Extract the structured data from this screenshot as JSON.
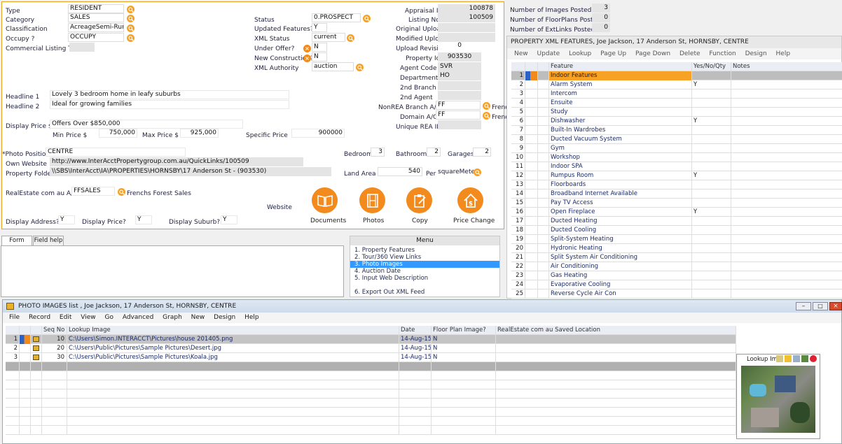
{
  "form": {
    "type_label": "Type",
    "type_value": "RESIDENT",
    "category_label": "Category",
    "category_value": "SALES",
    "classification_label": "Classification",
    "classification_value": "AcreageSemi-Rural",
    "occupy_label": "Occupy ?",
    "occupy_value": "OCCUPY",
    "commercial_label": "Commercial Listing Type",
    "status_label": "Status",
    "status_value": "0.PROSPECT",
    "updated_label": "Updated Features?",
    "updated_value": "Y",
    "xmlstatus_label": "XML Status",
    "xmlstatus_value": "current",
    "underoffer_label": "Under Offer?",
    "underoffer_value": "N",
    "newcon_label": "New Construction?",
    "newcon_value": "N",
    "xmlauth_label": "XML Authority",
    "xmlauth_value": "auction",
    "appraisal_label": "Appraisal Id",
    "appraisal_value": "100878",
    "listing_label": "Listing No",
    "listing_value": "100509",
    "origupload_label": "Original Upload",
    "modupload_label": "Modified Upload",
    "uprev_label": "Upload Revision",
    "uprev_value": "0",
    "propid_label": "Property Id",
    "propid_value": "903530",
    "agentcode_label": "Agent Code",
    "agentcode_value": "SVR",
    "dept_label": "Department",
    "dept_value": "HO",
    "branch2_label": "2nd Branch",
    "agent2_label": "2nd Agent",
    "nonrea_label": "NonREA Branch A/c",
    "nonrea_value": "FF",
    "nonrea_extra": "Frenc",
    "domain_label": "Domain A/C",
    "domain_value": "FF",
    "domain_extra": "Frenc",
    "uniquerea_label": "Unique REA ID",
    "headline1_label": "Headline 1",
    "headline1_value": "Lovely 3 bedroom home in leafy suburbs",
    "headline2_label": "Headline 2",
    "headline2_value": "Ideal for growing families",
    "dispprice_label": "Display Price $",
    "dispprice_value": "Offers Over $850,000",
    "minprice_label": "Min Price $",
    "minprice_value": "750,000",
    "maxprice_label": "Max Price $",
    "maxprice_value": "925,000",
    "specprice_label": "Specific Price",
    "specprice_value": "900000",
    "photopos_label": "*Photo Positions",
    "photopos_value": "CENTRE",
    "website_label": "Own Website",
    "website_value": "http://www.InterAcctPropertygroup.com.au/QuickLinks/100509",
    "folder_label": "Property Folder",
    "folder_value": "\\\\SBS\\InterAcct\\IA\\PROPERTIES\\HORNSBY\\17 Anderson St  - (903530)",
    "bed_label": "Bedrooms",
    "bed_value": "3",
    "bath_label": "Bathrooms",
    "bath_value": "2",
    "garage_label": "Garages",
    "garage_value": "2",
    "land_label": "Land Area",
    "land_value": "540",
    "per_label": "Per",
    "per_value": "squareMeter",
    "rea_label": "RealEstate com au A/c",
    "rea_value": "FFSALES",
    "rea_name": "Frenchs Forest Sales",
    "web_label": "Website",
    "dispaddr_label": "Display Address?",
    "dispaddr_value": "Y",
    "dispprice2_label": "Display Price?",
    "dispprice2_value": "Y",
    "dispsub_label": "Display Suburb?",
    "dispsub_value": "Y",
    "btn_documents": "Documents",
    "btn_photos": "Photos",
    "btn_copy": "Copy",
    "btn_price": "Price Change"
  },
  "counts": {
    "images_label": "Number of Images Posted",
    "images_value": "3",
    "floor_label": "Number of FloorPlans Posted",
    "floor_value": "0",
    "ext_label": "Number of ExtLinks Posted",
    "ext_value": "0"
  },
  "help": {
    "tab_form": "Form help",
    "tab_field": "Field help"
  },
  "menu": {
    "title": "Menu",
    "items": [
      "1. Property Features",
      "2. Tour/360 View Links",
      "3. Photo Images",
      "4. Auction Date",
      "5. Input Web Description",
      "6. Export Out XML Feed"
    ]
  },
  "features": {
    "title": "PROPERTY XML FEATURES, Joe Jackson, 17 Anderson St, HORNSBY, CENTRE",
    "menu": [
      "New",
      "Update",
      "Lookup",
      "Page Up",
      "Page Down",
      "Delete",
      "Function",
      "Design",
      "Help"
    ],
    "col_feature": "Feature",
    "col_yn": "Yes/No/Qty",
    "col_notes": "Notes",
    "rows": [
      {
        "n": "1",
        "f": "Indoor Features",
        "y": ""
      },
      {
        "n": "2",
        "f": "Alarm System",
        "y": "Y"
      },
      {
        "n": "3",
        "f": "Intercom",
        "y": ""
      },
      {
        "n": "4",
        "f": "Ensuite",
        "y": ""
      },
      {
        "n": "5",
        "f": "Study",
        "y": ""
      },
      {
        "n": "6",
        "f": "Dishwasher",
        "y": "Y"
      },
      {
        "n": "7",
        "f": "Built-In Wardrobes",
        "y": ""
      },
      {
        "n": "8",
        "f": "Ducted Vacuum System",
        "y": ""
      },
      {
        "n": "9",
        "f": "Gym",
        "y": ""
      },
      {
        "n": "10",
        "f": "Workshop",
        "y": ""
      },
      {
        "n": "11",
        "f": "Indoor SPA",
        "y": ""
      },
      {
        "n": "12",
        "f": "Rumpus Room",
        "y": "Y"
      },
      {
        "n": "13",
        "f": "Floorboards",
        "y": ""
      },
      {
        "n": "14",
        "f": "Broadband Internet Available",
        "y": ""
      },
      {
        "n": "15",
        "f": "Pay TV Access",
        "y": ""
      },
      {
        "n": "16",
        "f": "Open Fireplace",
        "y": "Y"
      },
      {
        "n": "17",
        "f": "Ducted Heating",
        "y": ""
      },
      {
        "n": "18",
        "f": "Ducted Cooling",
        "y": ""
      },
      {
        "n": "19",
        "f": "Split-System Heating",
        "y": ""
      },
      {
        "n": "20",
        "f": "Hydronic Heating",
        "y": ""
      },
      {
        "n": "21",
        "f": "Split System Air Conditioning",
        "y": ""
      },
      {
        "n": "22",
        "f": "Air Conditioning",
        "y": ""
      },
      {
        "n": "23",
        "f": "Gas Heating",
        "y": ""
      },
      {
        "n": "24",
        "f": "Evaporative Cooling",
        "y": ""
      },
      {
        "n": "25",
        "f": "Reverse Cycle Air Con",
        "y": ""
      }
    ]
  },
  "photos": {
    "title": "PHOTO IMAGES list , Joe Jackson, 17 Anderson St, HORNSBY, CENTRE",
    "menu": [
      "File",
      "Record",
      "Edit",
      "View",
      "Go",
      "Advanced",
      "Graph",
      "New",
      "Design",
      "Help"
    ],
    "col_seq": "Seq No",
    "col_lookup": "Lookup Image",
    "col_date": "Date",
    "col_floor": "Floor Plan Image?",
    "col_rea": "RealEstate com au Saved Location",
    "rows": [
      {
        "n": "1",
        "seq": "10",
        "path": "C:\\Users\\Simon.INTERACCT\\Pictures\\house 201405.png",
        "date": "14-Aug-15",
        "fp": "N"
      },
      {
        "n": "2",
        "seq": "20",
        "path": "C:\\Users\\Public\\Pictures\\Sample Pictures\\Desert.jpg",
        "date": "14-Aug-15",
        "fp": "N"
      },
      {
        "n": "3",
        "seq": "30",
        "path": "C:\\Users\\Public\\Pictures\\Sample Pictures\\Koala.jpg",
        "date": "14-Aug-15",
        "fp": "N"
      }
    ],
    "preview_label": "Lookup Ima"
  }
}
